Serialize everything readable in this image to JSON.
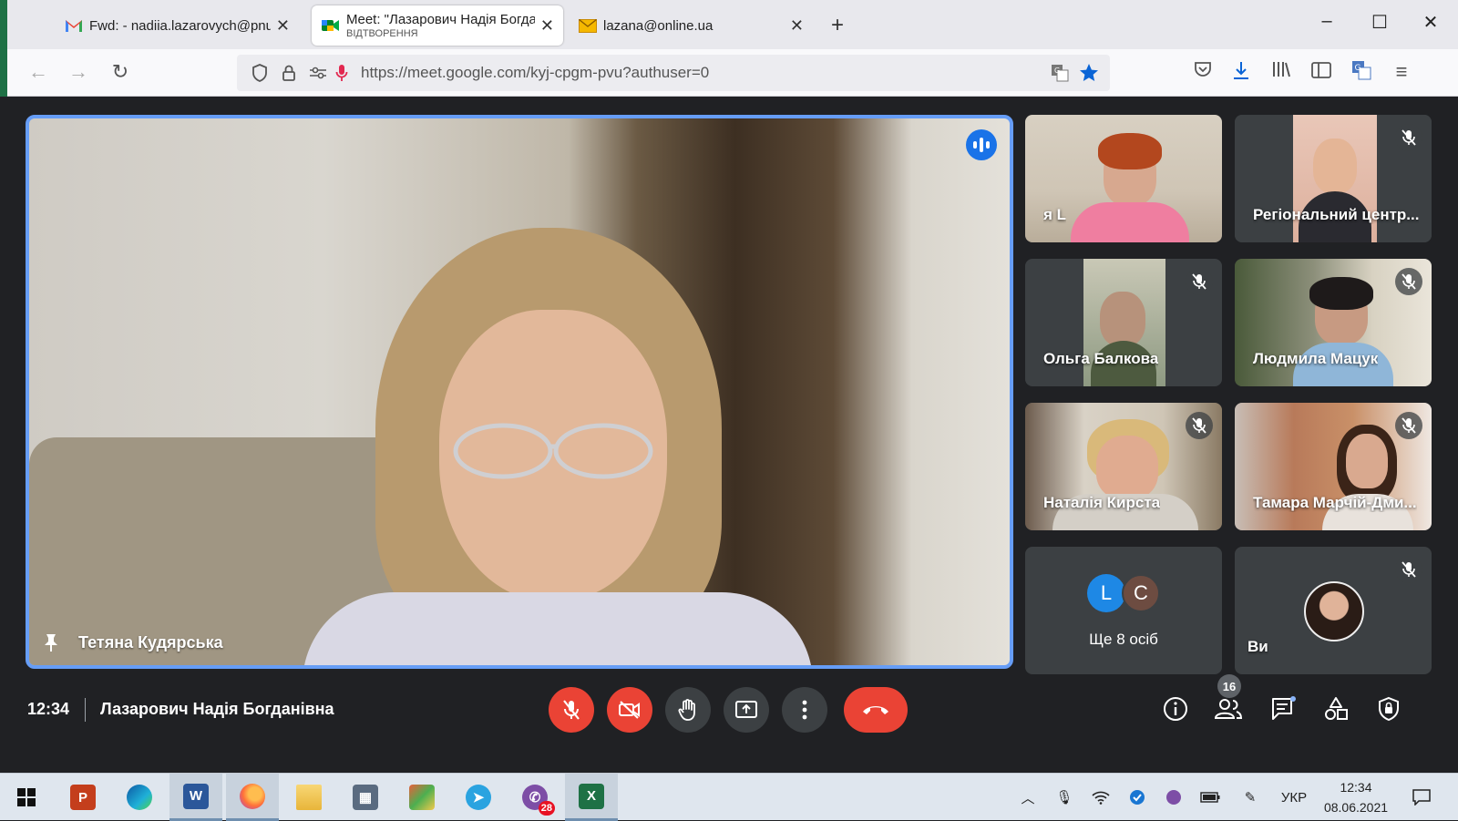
{
  "browser": {
    "tabs": [
      {
        "title": "Fwd: - nadiia.lazarovych@pnu.e",
        "subtitle": "",
        "icon": "gmail-icon",
        "active": false
      },
      {
        "title": "Meet: \"Лазарович Надія Богда",
        "subtitle": "ВІДТВОРЕННЯ",
        "icon": "meet-icon",
        "active": true
      },
      {
        "title": "lazana@online.ua",
        "subtitle": "",
        "icon": "mail-envelope-icon",
        "active": false
      }
    ],
    "new_tab": "+",
    "url": "https://meet.google.com/kyj-cpgm-pvu?authuser=0"
  },
  "meet": {
    "main_speaker": "Тетяна Кудярська",
    "participants": [
      {
        "name": "я L",
        "muted": false
      },
      {
        "name": "Регіональний центр...",
        "muted": true
      },
      {
        "name": "Ольга Балкова",
        "muted": true
      },
      {
        "name": "Людмила Мацук",
        "muted": true
      },
      {
        "name": "Наталія Кирста",
        "muted": true
      },
      {
        "name": "Тамара Марчій-Дми...",
        "muted": true
      }
    ],
    "others": {
      "avatars": [
        {
          "letter": "L",
          "color": "#1e88e5"
        },
        {
          "letter": "C",
          "color": "#6d4c41"
        }
      ],
      "label": "Ще 8 осіб"
    },
    "self": {
      "name": "Ви",
      "muted": true
    },
    "time": "12:34",
    "title": "Лазарович Надія Богданівна",
    "people_count": "16"
  },
  "taskbar": {
    "apps": [
      "windows-start-icon",
      "powerpoint-icon",
      "edge-icon",
      "word-icon",
      "firefox-icon",
      "file-explorer-icon",
      "calculator-icon",
      "paint-icon",
      "telegram-icon",
      "viber-icon",
      "excel-icon"
    ],
    "viber_badge": "28",
    "language": "УКР",
    "time": "12:34",
    "date": "08.06.2021"
  },
  "colors": {
    "accent_blue": "#669df6",
    "end_call_red": "#ea4335",
    "meet_bg": "#202124"
  }
}
